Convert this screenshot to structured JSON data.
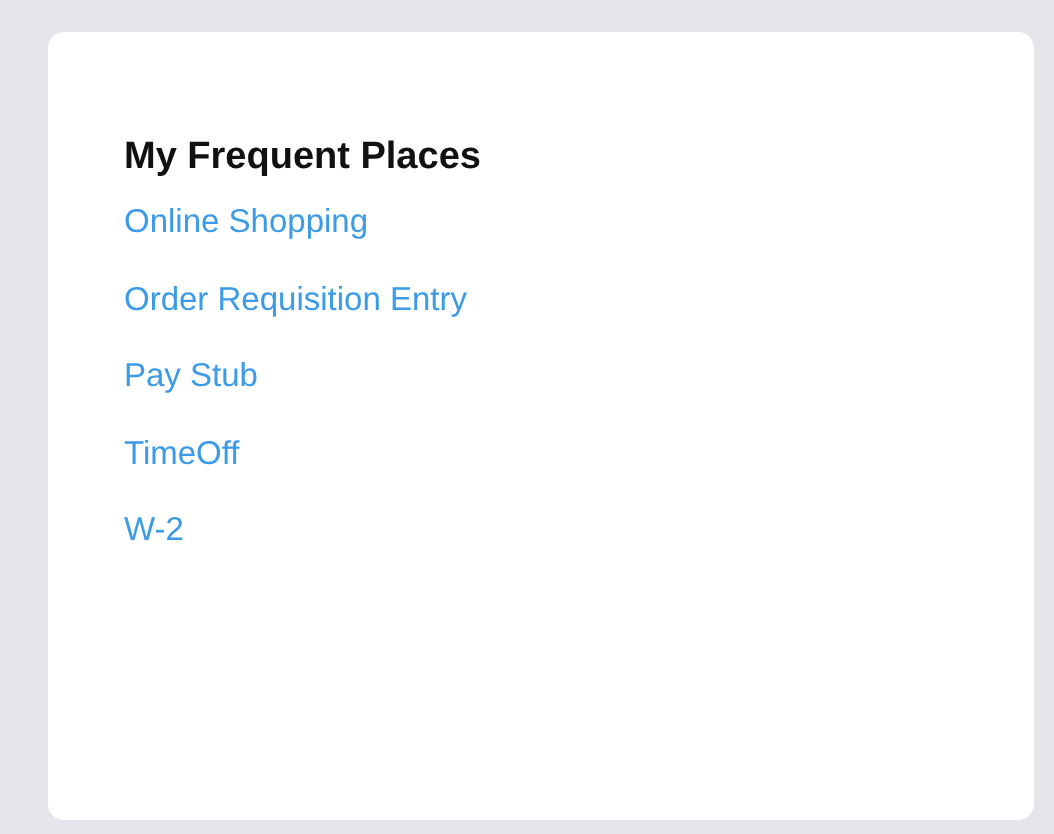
{
  "card": {
    "title": "My Frequent Places",
    "links": [
      {
        "label": "Online Shopping"
      },
      {
        "label": "Order Requisition Entry"
      },
      {
        "label": "Pay Stub"
      },
      {
        "label": "TimeOff"
      },
      {
        "label": "W-2"
      }
    ]
  }
}
